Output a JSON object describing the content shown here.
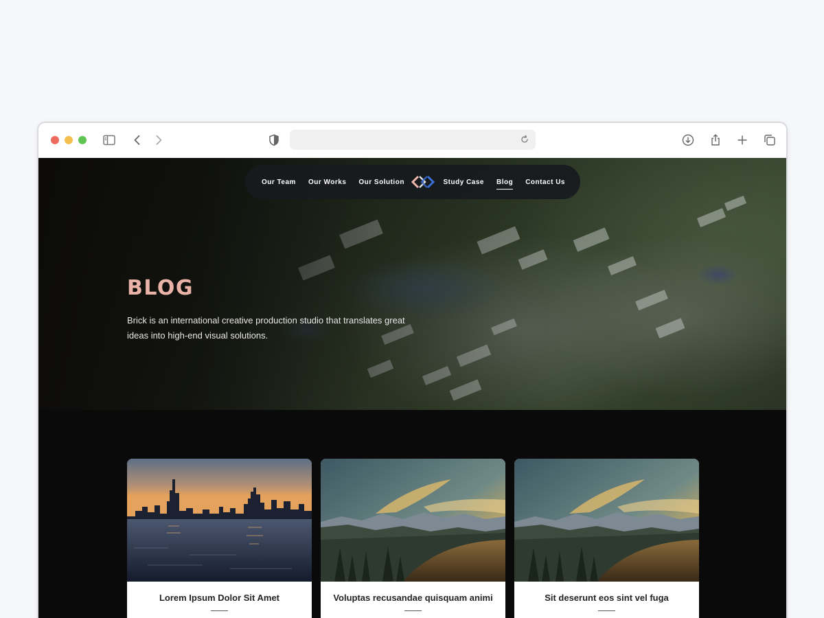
{
  "browser": {
    "traffic_lights": {
      "close": "#ec6a5e",
      "minimize": "#f4bf4f",
      "maximize": "#61c554"
    },
    "toolbar_icons": [
      "sidebar-icon",
      "back-icon",
      "forward-icon",
      "shield-icon",
      "reload-icon",
      "download-icon",
      "share-icon",
      "new-tab-icon",
      "tabs-overview-icon"
    ],
    "url": ""
  },
  "nav": {
    "left_items": [
      {
        "label": "Our Team"
      },
      {
        "label": "Our Works"
      },
      {
        "label": "Our Solution"
      }
    ],
    "right_items": [
      {
        "label": "Study Case"
      },
      {
        "label": "Blog",
        "active": true
      },
      {
        "label": "Contact Us"
      }
    ],
    "logo_colors": [
      "#f0b7ad",
      "#3b6fd8"
    ]
  },
  "hero": {
    "title": "BLOG",
    "description": "Brick is an international creative production studio that translates great ideas into high-end visual solutions.",
    "title_color": "#eab3a8"
  },
  "posts": [
    {
      "title": "Lorem Ipsum Dolor Sit Amet",
      "image": "city-skyline-sunset-photo"
    },
    {
      "title": "Voluptas recusandae quisquam animi",
      "image": "mountain-landscape-sunset-photo"
    },
    {
      "title": "Sit deserunt eos sint vel fuga",
      "image": "mountain-landscape-sunset-photo"
    }
  ]
}
